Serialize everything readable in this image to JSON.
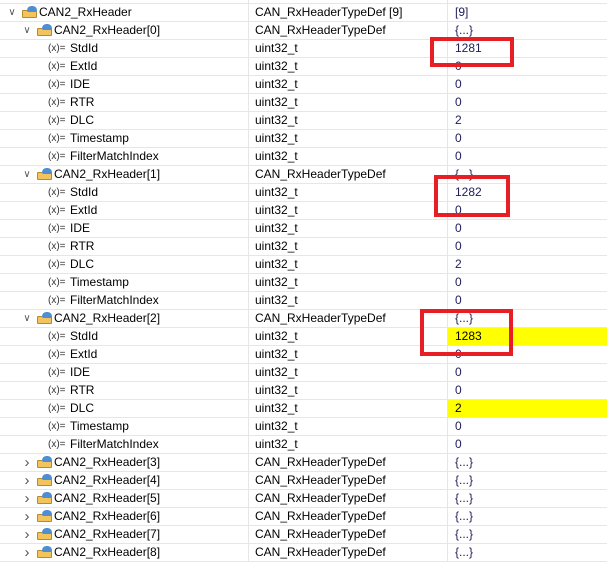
{
  "rows": [
    {
      "level": 0,
      "kind": "struct",
      "expanded": true,
      "name": "CAN2_RxHeader",
      "type": "CAN_RxHeaderTypeDef [9]",
      "value": "[9]"
    },
    {
      "level": 1,
      "kind": "struct",
      "expanded": true,
      "name": "CAN2_RxHeader[0]",
      "type": "CAN_RxHeaderTypeDef",
      "value": "{...}"
    },
    {
      "level": 2,
      "kind": "var",
      "name": "StdId",
      "type": "uint32_t",
      "value": "1281"
    },
    {
      "level": 2,
      "kind": "var",
      "name": "ExtId",
      "type": "uint32_t",
      "value": "0"
    },
    {
      "level": 2,
      "kind": "var",
      "name": "IDE",
      "type": "uint32_t",
      "value": "0"
    },
    {
      "level": 2,
      "kind": "var",
      "name": "RTR",
      "type": "uint32_t",
      "value": "0"
    },
    {
      "level": 2,
      "kind": "var",
      "name": "DLC",
      "type": "uint32_t",
      "value": "2"
    },
    {
      "level": 2,
      "kind": "var",
      "name": "Timestamp",
      "type": "uint32_t",
      "value": "0"
    },
    {
      "level": 2,
      "kind": "var",
      "name": "FilterMatchIndex",
      "type": "uint32_t",
      "value": "0"
    },
    {
      "level": 1,
      "kind": "struct",
      "expanded": true,
      "name": "CAN2_RxHeader[1]",
      "type": "CAN_RxHeaderTypeDef",
      "value": "{...}"
    },
    {
      "level": 2,
      "kind": "var",
      "name": "StdId",
      "type": "uint32_t",
      "value": "1282"
    },
    {
      "level": 2,
      "kind": "var",
      "name": "ExtId",
      "type": "uint32_t",
      "value": "0"
    },
    {
      "level": 2,
      "kind": "var",
      "name": "IDE",
      "type": "uint32_t",
      "value": "0"
    },
    {
      "level": 2,
      "kind": "var",
      "name": "RTR",
      "type": "uint32_t",
      "value": "0"
    },
    {
      "level": 2,
      "kind": "var",
      "name": "DLC",
      "type": "uint32_t",
      "value": "2"
    },
    {
      "level": 2,
      "kind": "var",
      "name": "Timestamp",
      "type": "uint32_t",
      "value": "0"
    },
    {
      "level": 2,
      "kind": "var",
      "name": "FilterMatchIndex",
      "type": "uint32_t",
      "value": "0"
    },
    {
      "level": 1,
      "kind": "struct",
      "expanded": true,
      "name": "CAN2_RxHeader[2]",
      "type": "CAN_RxHeaderTypeDef",
      "value": "{...}"
    },
    {
      "level": 2,
      "kind": "var",
      "name": "StdId",
      "type": "uint32_t",
      "value": "1283",
      "changed": true
    },
    {
      "level": 2,
      "kind": "var",
      "name": "ExtId",
      "type": "uint32_t",
      "value": "0"
    },
    {
      "level": 2,
      "kind": "var",
      "name": "IDE",
      "type": "uint32_t",
      "value": "0"
    },
    {
      "level": 2,
      "kind": "var",
      "name": "RTR",
      "type": "uint32_t",
      "value": "0"
    },
    {
      "level": 2,
      "kind": "var",
      "name": "DLC",
      "type": "uint32_t",
      "value": "2",
      "changed": true
    },
    {
      "level": 2,
      "kind": "var",
      "name": "Timestamp",
      "type": "uint32_t",
      "value": "0"
    },
    {
      "level": 2,
      "kind": "var",
      "name": "FilterMatchIndex",
      "type": "uint32_t",
      "value": "0"
    },
    {
      "level": 1,
      "kind": "struct",
      "expanded": false,
      "name": "CAN2_RxHeader[3]",
      "type": "CAN_RxHeaderTypeDef",
      "value": "{...}"
    },
    {
      "level": 1,
      "kind": "struct",
      "expanded": false,
      "name": "CAN2_RxHeader[4]",
      "type": "CAN_RxHeaderTypeDef",
      "value": "{...}"
    },
    {
      "level": 1,
      "kind": "struct",
      "expanded": false,
      "name": "CAN2_RxHeader[5]",
      "type": "CAN_RxHeaderTypeDef",
      "value": "{...}"
    },
    {
      "level": 1,
      "kind": "struct",
      "expanded": false,
      "name": "CAN2_RxHeader[6]",
      "type": "CAN_RxHeaderTypeDef",
      "value": "{...}"
    },
    {
      "level": 1,
      "kind": "struct",
      "expanded": false,
      "name": "CAN2_RxHeader[7]",
      "type": "CAN_RxHeaderTypeDef",
      "value": "{...}"
    },
    {
      "level": 1,
      "kind": "struct",
      "expanded": false,
      "name": "CAN2_RxHeader[8]",
      "type": "CAN_RxHeaderTypeDef",
      "value": "{...}"
    }
  ],
  "var_icon": "(x)=",
  "colors": {
    "highlight": "#ffff00",
    "annotation": "#e81e25"
  }
}
